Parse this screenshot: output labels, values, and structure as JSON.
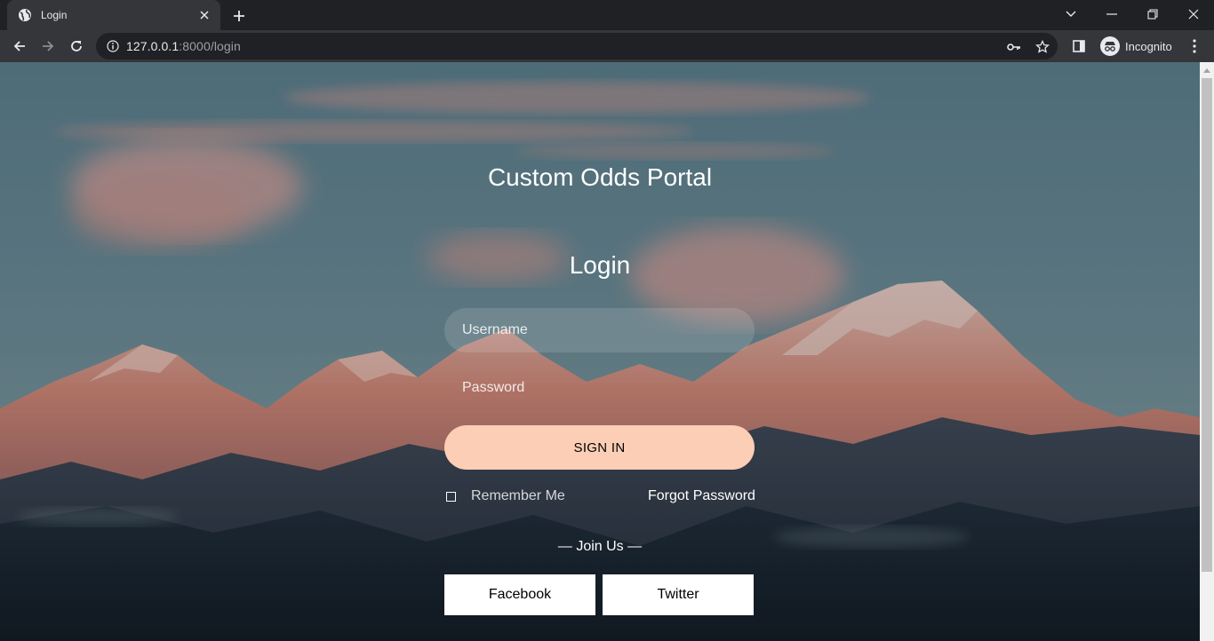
{
  "browser": {
    "tab_title": "Login",
    "url_host": "127.0.0.1",
    "url_path": ":8000/login",
    "profile_label": "Incognito"
  },
  "page": {
    "site_title": "Custom Odds Portal",
    "heading": "Login",
    "username_placeholder": "Username",
    "password_placeholder": "Password",
    "signin_label": "SIGN IN",
    "remember_label": "Remember Me",
    "forgot_label": "Forgot Password",
    "join_label": "— Join Us —",
    "facebook_label": "Facebook",
    "twitter_label": "Twitter"
  },
  "colors": {
    "signin_button": "#fbceb5",
    "chrome_dark": "#202124",
    "chrome_toolbar": "#35363a"
  }
}
